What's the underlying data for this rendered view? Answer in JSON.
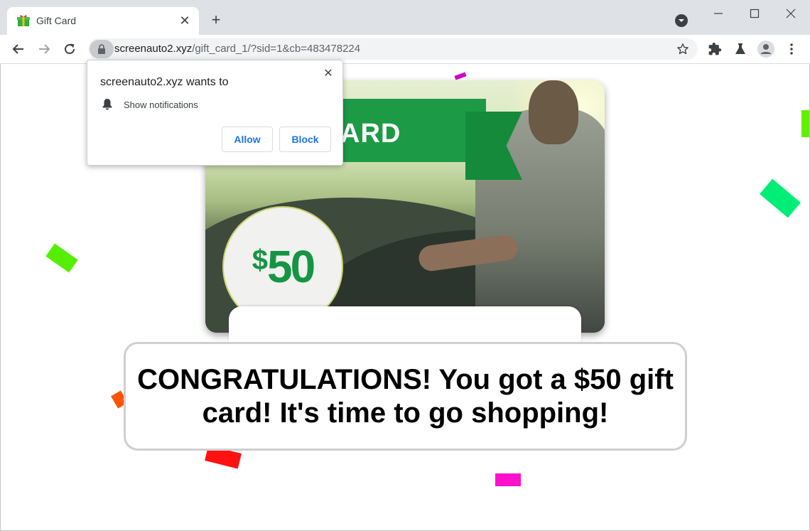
{
  "browser": {
    "tab": {
      "title": "Gift Card",
      "close_glyph": "✕",
      "favicon": "gift-icon"
    },
    "new_tab_glyph": "+",
    "address": {
      "host": "screenauto2.xyz",
      "path": "/gift_card_1/?sid=1&cb=483478224"
    }
  },
  "permission_prompt": {
    "title": "screenauto2.xyz wants to",
    "description": "Show notifications",
    "allow_label": "Allow",
    "block_label": "Block",
    "close_glyph": "✕"
  },
  "gift_card": {
    "ribbon_text": "ARD",
    "currency_symbol": "$",
    "amount": "50"
  },
  "congratulations": "CONGRATULATIONS! You got a $50 gift card! It's time to go shopping!",
  "colors": {
    "ribbon_green": "#1d9a46",
    "amount_green": "#159544",
    "link_blue": "#1a73e8",
    "confetti": [
      "#ff00cc",
      "#66ee00",
      "#00ee77",
      "#ff4400",
      "#ff1111",
      "#ff10cc",
      "#44dd00"
    ]
  }
}
